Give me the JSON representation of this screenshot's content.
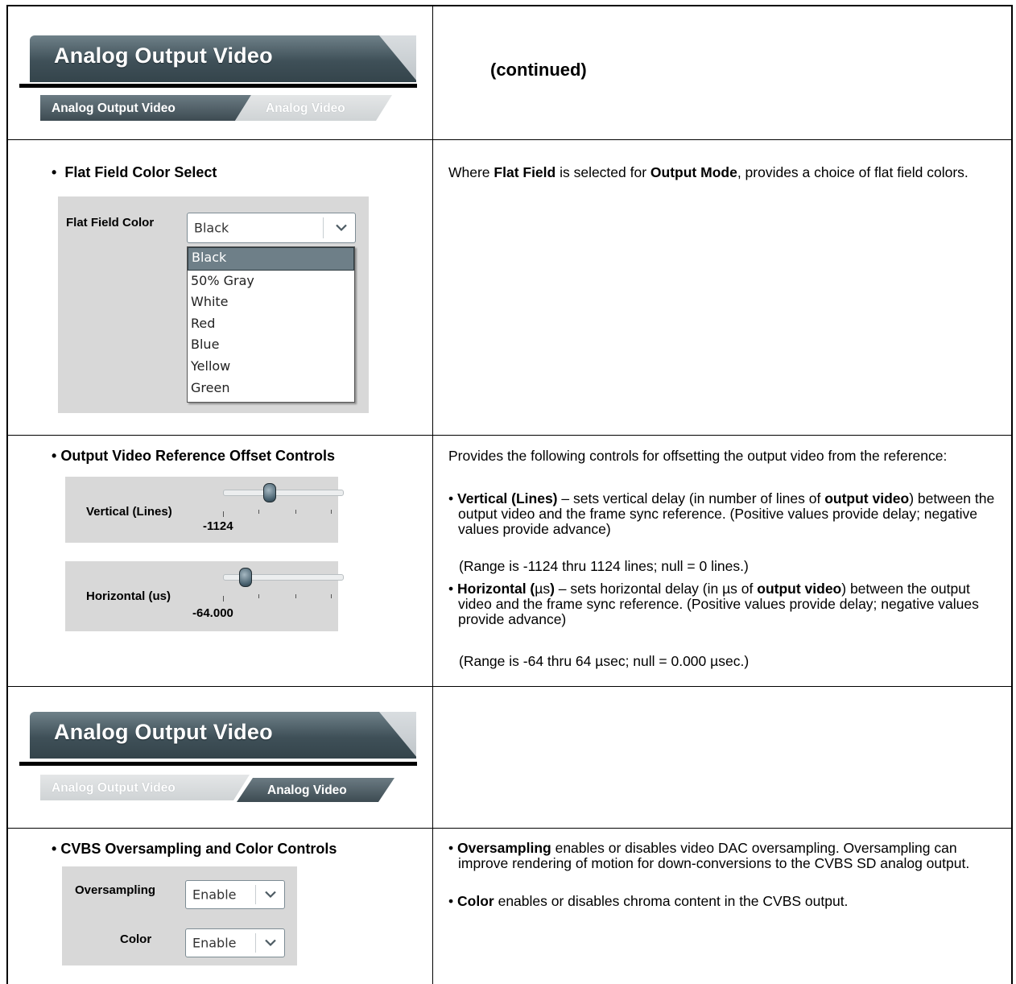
{
  "page_header": {
    "banner_title": "Analog Output Video",
    "continued_label": "(continued)"
  },
  "tabs_top": [
    {
      "label": "Analog Output Video",
      "active": true
    },
    {
      "label": "Analog Video",
      "active": false
    }
  ],
  "flat_field": {
    "heading": "Flat Field Color Select",
    "control_label": "Flat Field Color",
    "selected_value": "Black",
    "options": [
      "Black",
      "50% Gray",
      "White",
      "Red",
      "Blue",
      "Yellow",
      "Green"
    ],
    "desc": {
      "t1": "Where ",
      "b1": "Flat Field",
      "t2": " is selected for ",
      "b2": "Output Mode",
      "t3": ", provides a choice of flat field colors."
    }
  },
  "offset": {
    "heading": "Output Video Reference Offset Controls",
    "vertical_label": "Vertical (Lines)",
    "vertical_value": "-1124",
    "horizontal_label": "Horizontal (us)",
    "horizontal_value": "-64.000",
    "intro": "Provides the following controls for offsetting the output video from the reference:",
    "vertical_item": {
      "b1": "Vertical (Lines)",
      "t1": " – sets vertical delay (in number of lines of ",
      "b2": "output video",
      "t2": ") between the output video and the frame sync reference. (Positive values provide delay; negative values provide advance)",
      "range": "(Range is -1124 thru 1124 lines; null = 0 lines.)"
    },
    "horizontal_item": {
      "b1": "Horizontal (",
      "mu": "µs",
      "b1b": ")",
      "t1": " – sets horizontal delay (in µs of ",
      "b2": "output video",
      "t2": ") between the output video and the frame sync reference. (Positive values provide delay; negative values provide advance)",
      "range": "(Range is -64 thru 64 µsec; null = 0.000 µsec.)"
    }
  },
  "tabs_bottom": [
    {
      "label": "Analog Output Video",
      "active": false
    },
    {
      "label": "Analog Video",
      "active": true
    }
  ],
  "cvbs": {
    "heading": "CVBS Oversampling and Color Controls",
    "oversampling_label": "Oversampling",
    "oversampling_value": "Enable",
    "color_label": "Color",
    "color_value": "Enable",
    "item1": {
      "b1": "Oversampling",
      "t1": " enables or disables video DAC oversampling. Oversampling can improve rendering of motion for down-conversions to the CVBS SD analog output."
    },
    "item2": {
      "b1": "Color",
      "t1": " enables or disables chroma content in the CVBS output."
    }
  },
  "bullet_glyph": "•"
}
